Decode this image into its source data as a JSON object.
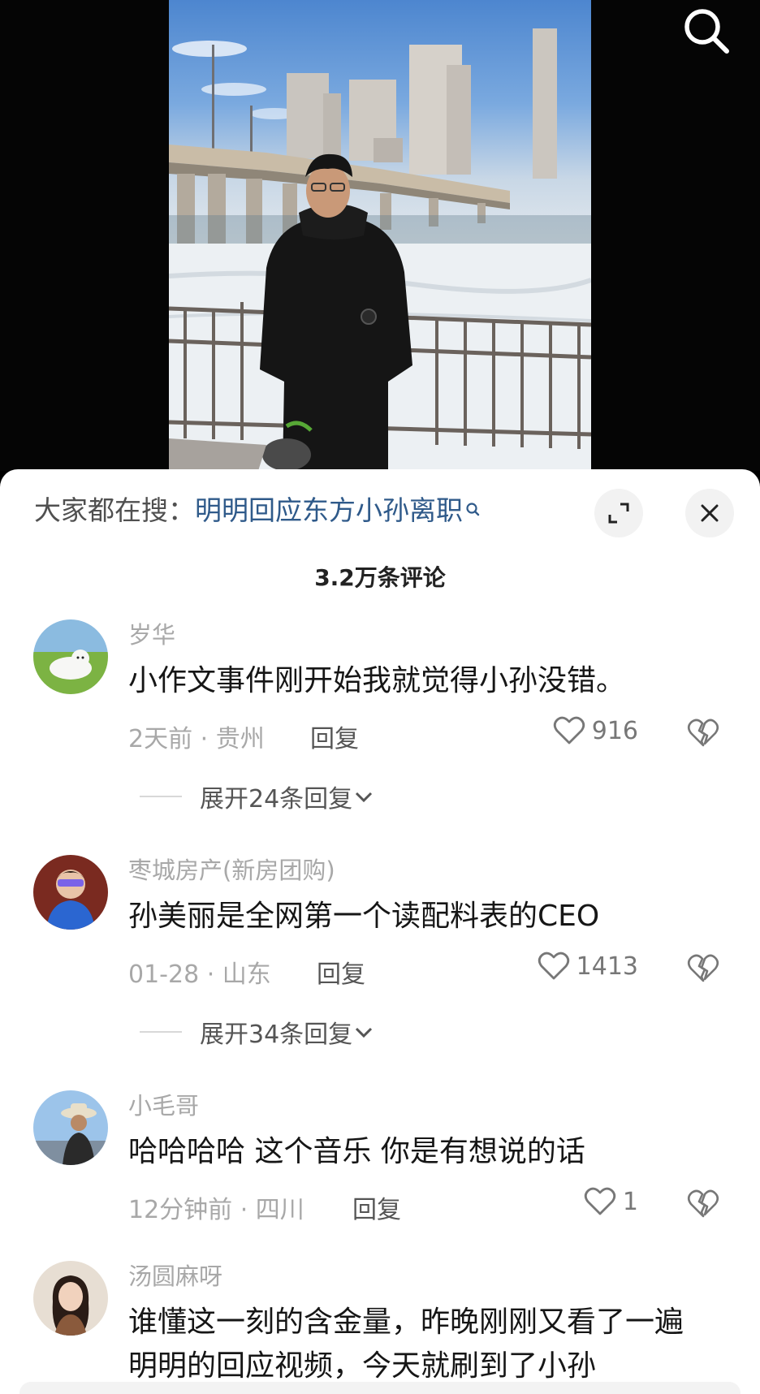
{
  "search_bar": {
    "prefix": "大家都在搜：",
    "query": "明明回应东方小孙离职"
  },
  "comments_header": {
    "count_label": "3.2万条评论"
  },
  "comments": [
    {
      "username": "岁华",
      "text": "小作文事件刚开始我就觉得小孙没错。",
      "meta": "2天前 · 贵州",
      "reply_label": "回复",
      "likes": "916",
      "expand_label": "展开24条回复"
    },
    {
      "username": "枣城房产(新房团购)",
      "text": "孙美丽是全网第一个读配料表的CEO",
      "meta": "01-28 · 山东",
      "reply_label": "回复",
      "likes": "1413",
      "expand_label": "展开34条回复"
    },
    {
      "username": "小毛哥",
      "text": "哈哈哈哈 这个音乐 你是有想说的话",
      "meta": "12分钟前 · 四川",
      "reply_label": "回复",
      "likes": "1"
    },
    {
      "username": "汤圆麻呀",
      "text": "谁懂这一刻的含金量，昨晚刚刚又看了一遍",
      "text_line2": "明明的回应视频，今天就刷到了小孙"
    }
  ],
  "icons": {
    "search": "search-icon",
    "expand": "expand-icon",
    "close": "close-icon",
    "like": "heart-outline-icon",
    "dislike": "broken-heart-icon",
    "chevron": "chevron-down-icon"
  },
  "colors": {
    "sheet_background": "#ffffff",
    "search_query": "#2f5a8a",
    "muted_text": "#a8a8a8"
  }
}
